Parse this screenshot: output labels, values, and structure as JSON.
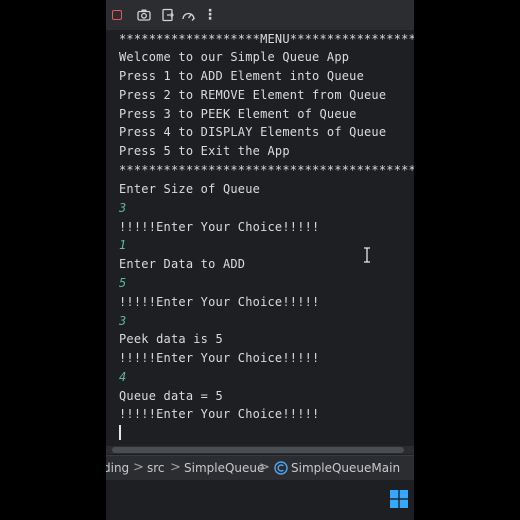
{
  "toolbar": {
    "icons": [
      "stop-icon",
      "camera-icon",
      "exit-icon",
      "gauge-icon",
      "more-icon"
    ],
    "stop_color": "#e55b5b"
  },
  "console": {
    "text_color": "#d9dbdf",
    "input_color": "#5fb88f",
    "lines": [
      {
        "text": "*******************MENU******************",
        "kind": "output"
      },
      {
        "text": "Welcome to our Simple Queue App",
        "kind": "output"
      },
      {
        "text": "Press 1 to ADD Element into Queue",
        "kind": "output"
      },
      {
        "text": "Press 2 to REMOVE Element from Queue",
        "kind": "output"
      },
      {
        "text": "Press 3 to PEEK Element of Queue",
        "kind": "output"
      },
      {
        "text": "Press 4 to DISPLAY Elements of Queue",
        "kind": "output"
      },
      {
        "text": "Press 5 to Exit the App",
        "kind": "output"
      },
      {
        "text": "*****************************************",
        "kind": "output"
      },
      {
        "text": "Enter Size of Queue",
        "kind": "output"
      },
      {
        "text": "3",
        "kind": "input"
      },
      {
        "text": "!!!!!Enter Your Choice!!!!!",
        "kind": "output"
      },
      {
        "text": "1",
        "kind": "input"
      },
      {
        "text": "Enter Data to ADD",
        "kind": "output"
      },
      {
        "text": "5",
        "kind": "input"
      },
      {
        "text": "!!!!!Enter Your Choice!!!!!",
        "kind": "output"
      },
      {
        "text": "3",
        "kind": "input"
      },
      {
        "text": "Peek data is 5",
        "kind": "output"
      },
      {
        "text": "!!!!!Enter Your Choice!!!!!",
        "kind": "output"
      },
      {
        "text": "4",
        "kind": "input"
      },
      {
        "text": "Queue data = 5",
        "kind": "output"
      },
      {
        "text": "!!!!!Enter Your Choice!!!!!",
        "kind": "output"
      }
    ]
  },
  "breadcrumb": {
    "items": [
      "ding",
      "src",
      "SimpleQueue",
      "SimpleQueueMain"
    ],
    "separator": ">",
    "class_icon_color": "#4ea6f2"
  },
  "taskbar": {
    "start_icon": "windows-logo-icon",
    "accent": "#34a8ff"
  }
}
